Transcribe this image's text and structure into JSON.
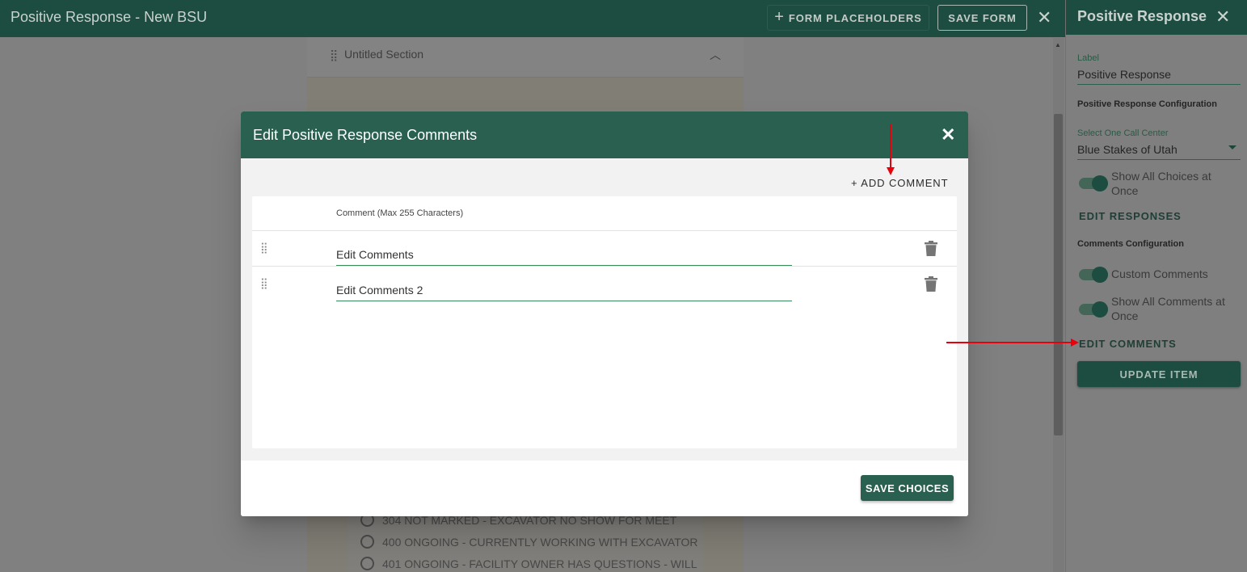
{
  "app": {
    "title": "Positive Response - New BSU",
    "placeholders_label": "FORM PLACEHOLDERS",
    "save_form_label": "SAVE FORM",
    "close_icon": "close-icon"
  },
  "form": {
    "section_title": "Untitled Section",
    "radio_options": [
      "304 NOT MARKED - EXCAVATOR NO SHOW FOR MEET",
      "400 ONGOING - CURRENTLY WORKING WITH EXCAVATOR",
      "401 ONGOING - FACILITY OWNER HAS QUESTIONS - WILL"
    ]
  },
  "panel": {
    "title": "Positive Response",
    "label_caption": "Label",
    "label_value": "Positive Response",
    "config_heading": "Positive Response Configuration",
    "call_center_caption": "Select One Call Center",
    "call_center_value": "Blue Stakes of Utah",
    "show_all_choices_label": "Show All Choices at Once",
    "edit_responses_label": "EDIT RESPONSES",
    "comments_heading": "Comments Configuration",
    "custom_comments_label": "Custom Comments",
    "show_all_comments_label": "Show All Comments at Once",
    "edit_comments_label": "EDIT COMMENTS",
    "update_item_label": "UPDATE ITEM"
  },
  "modal": {
    "title": "Edit Positive Response Comments",
    "add_comment_label": "+ ADD COMMENT",
    "column_header": "Comment (Max 255 Characters)",
    "comments": [
      "Edit Comments",
      "Edit Comments 2"
    ],
    "save_choices_label": "SAVE CHOICES"
  },
  "colors": {
    "brand": "#29604f",
    "annotation_arrow": "#e8000d"
  }
}
